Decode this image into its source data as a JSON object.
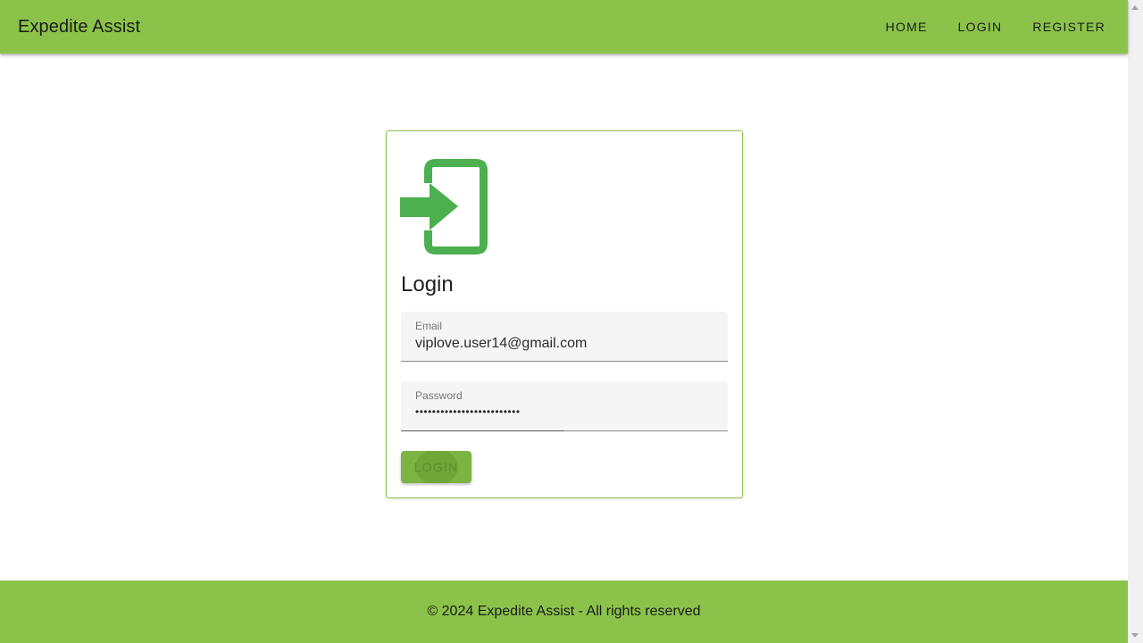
{
  "app": {
    "title": "Expedite Assist"
  },
  "nav": {
    "items": [
      {
        "label": "HOME"
      },
      {
        "label": "LOGIN"
      },
      {
        "label": "REGISTER"
      }
    ]
  },
  "login_card": {
    "icon": "login-arrow-door-icon",
    "title": "Login",
    "email": {
      "label": "Email",
      "value": "viplove.user14@gmail.com"
    },
    "password": {
      "label": "Password",
      "value": "•••••••••••••••••••••••••"
    },
    "submit_label": "LOGIN"
  },
  "footer": {
    "text": "© 2024 Expedite Assist - All rights reserved"
  },
  "colors": {
    "brand": "#8bc34a",
    "button": "#7cb342",
    "icon": "#4caf50"
  }
}
